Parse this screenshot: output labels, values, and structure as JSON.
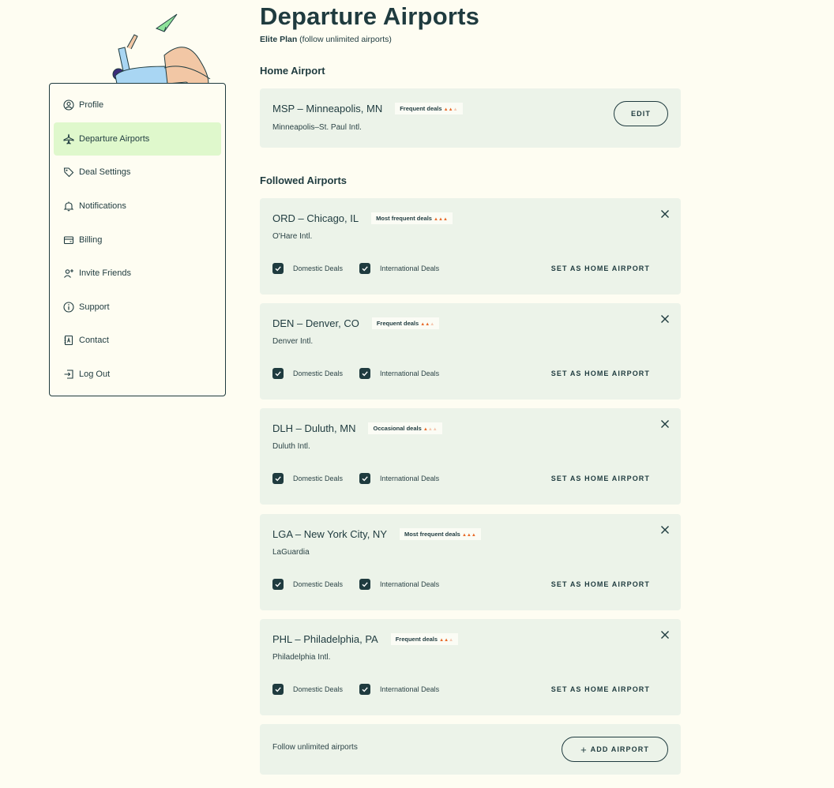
{
  "header": {
    "title": "Departure Airports",
    "plan_bold": "Elite Plan",
    "plan_rest": " (follow unlimited airports)"
  },
  "sidebar": {
    "items": [
      {
        "label": "Profile",
        "icon": "user-circle-icon"
      },
      {
        "label": "Departure Airports",
        "icon": "airplane-icon",
        "active": true
      },
      {
        "label": "Deal Settings",
        "icon": "tag-icon"
      },
      {
        "label": "Notifications",
        "icon": "bell-icon"
      },
      {
        "label": "Billing",
        "icon": "wallet-icon"
      },
      {
        "label": "Invite Friends",
        "icon": "add-user-icon"
      },
      {
        "label": "Support",
        "icon": "info-icon"
      },
      {
        "label": "Contact",
        "icon": "contact-book-icon"
      },
      {
        "label": "Log Out",
        "icon": "logout-icon"
      }
    ]
  },
  "home": {
    "section_title": "Home Airport",
    "code": "MSP – Minneapolis, MN",
    "badge": "Frequent deals",
    "flames_active": 2,
    "name": "Minneapolis–St. Paul Intl.",
    "edit_label": "EDIT"
  },
  "followed": {
    "section_title": "Followed Airports",
    "domestic_label": "Domestic Deals",
    "international_label": "International Deals",
    "set_home_label": "SET AS HOME AIRPORT",
    "airports": [
      {
        "code": "ORD – Chicago, IL",
        "badge": "Most frequent deals",
        "flames_active": 3,
        "name": "O'Hare Intl."
      },
      {
        "code": "DEN – Denver, CO",
        "badge": "Frequent deals",
        "flames_active": 2,
        "name": "Denver Intl."
      },
      {
        "code": "DLH – Duluth, MN",
        "badge": "Occasional deals",
        "flames_active": 1,
        "name": "Duluth Intl."
      },
      {
        "code": "LGA – New York City, NY",
        "badge": "Most frequent deals",
        "flames_active": 3,
        "name": "LaGuardia"
      },
      {
        "code": "PHL – Philadelphia, PA",
        "badge": "Frequent deals",
        "flames_active": 2,
        "name": "Philadelphia Intl."
      }
    ]
  },
  "footer": {
    "text": "Follow unlimited airports",
    "add_label": "ADD AIRPORT"
  },
  "colors": {
    "background": "#fefdf2",
    "card": "#ecf3e9",
    "dark": "#1f3b3f",
    "active_nav": "#dff8cc",
    "flame": "#e86b2a"
  }
}
